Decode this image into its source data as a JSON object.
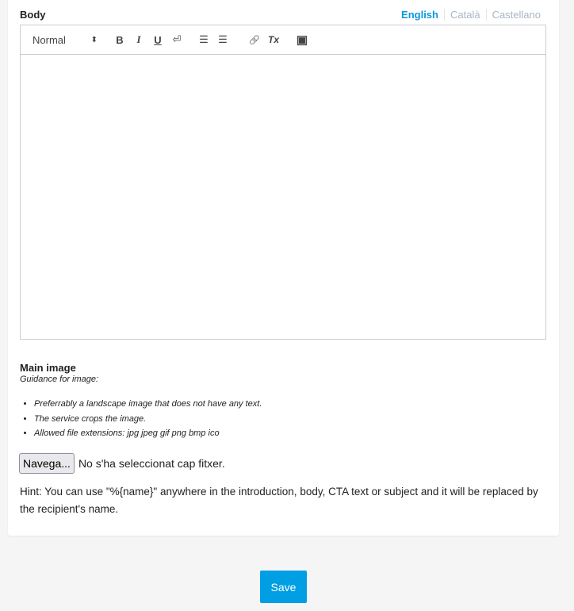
{
  "body": {
    "label": "Body",
    "languages": [
      "English",
      "Català",
      "Castellano"
    ],
    "active_language": "English"
  },
  "toolbar": {
    "format": "Normal",
    "format_arrow": "⬍",
    "bold": "B",
    "italic": "I",
    "underline": "U",
    "linebreak": "⏎",
    "ordered_list": "☰",
    "bullet_list": "☰",
    "link": "🔗",
    "clear_format": "Tx",
    "video": "▣"
  },
  "main_image": {
    "label": "Main image",
    "guidance": "Guidance for image:",
    "items": [
      "Preferrably a landscape image that does not have any text.",
      "The service crops the image.",
      "Allowed file extensions: jpg jpeg gif png bmp ico"
    ],
    "browse_label": "Navega...",
    "no_file": "No s'ha seleccionat cap fitxer."
  },
  "hint": "Hint: You can use \"%{name}\" anywhere in the introduction, body, CTA text or subject and it will be replaced by the recipient's name.",
  "save_label": "Save",
  "colors": {
    "accent": "#009fe3",
    "background": "#f5f5f5"
  }
}
